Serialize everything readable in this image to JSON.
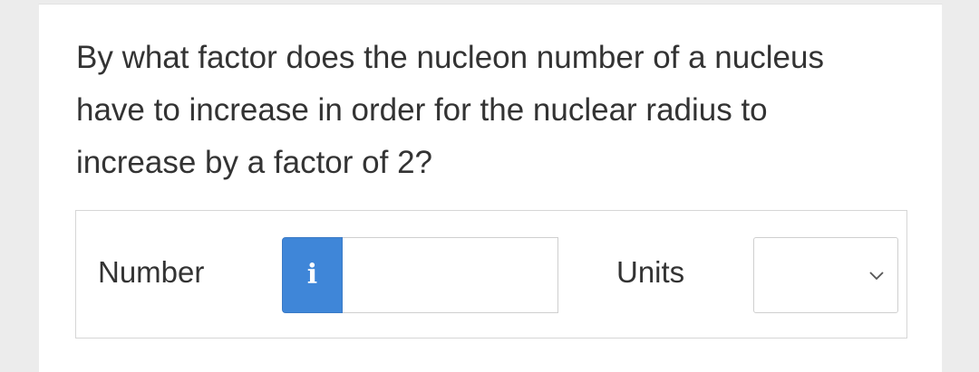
{
  "question": {
    "text": "By what factor does the nucleon number of a nucleus have to increase in order for the nuclear radius to increase by a factor of 2?"
  },
  "answer": {
    "number_label": "Number",
    "info_icon": "info-icon",
    "info_glyph": "i",
    "number_value": "",
    "units_label": "Units",
    "units_selected": "",
    "units_icon": "chevron-down-icon"
  },
  "colors": {
    "info_button": "#3f86d8",
    "text": "#333333",
    "border": "#cfcfcf"
  }
}
